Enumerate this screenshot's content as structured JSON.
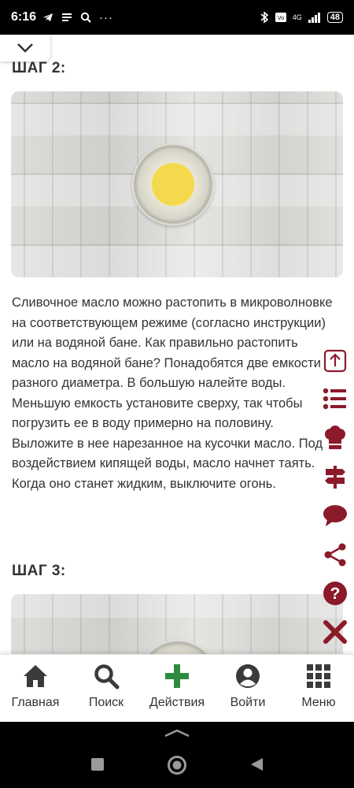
{
  "status_bar": {
    "time": "6:16",
    "network": "4G",
    "battery": "48"
  },
  "article": {
    "steps": [
      {
        "heading": "ШАГ 2:",
        "text": "Сливочное масло можно растопить в микроволновке на соответствующем режиме (согласно инструкции) или на водяной бане. Как правильно растопить масло на водяной бане? Понадобятся две емкости разного диаметра. В большую налейте воды. Меньшую емкость установите сверху, так чтобы погрузить ее в воду примерно на половину. Выложите в нее нарезанное на кусочки масло. Под воздействием кипящей воды, масло начнет таять. Когда оно станет жидким, выключите огонь."
      },
      {
        "heading": "ШАГ 3:"
      }
    ]
  },
  "float_icons": [
    "arrow-up-icon",
    "list-icon",
    "chef-hat-icon",
    "signpost-icon",
    "comment-icon",
    "share-icon",
    "help-icon",
    "close-icon"
  ],
  "bottom_nav": {
    "items": [
      {
        "label": "Главная",
        "icon": "home-icon"
      },
      {
        "label": "Поиск",
        "icon": "search-icon"
      },
      {
        "label": "Действия",
        "icon": "plus-icon"
      },
      {
        "label": "Войти",
        "icon": "user-icon"
      },
      {
        "label": "Меню",
        "icon": "grid-icon"
      }
    ]
  },
  "colors": {
    "accent": "#8b1a2b",
    "action_green": "#2e8b3e",
    "nav_icon": "#3a3a3a"
  }
}
